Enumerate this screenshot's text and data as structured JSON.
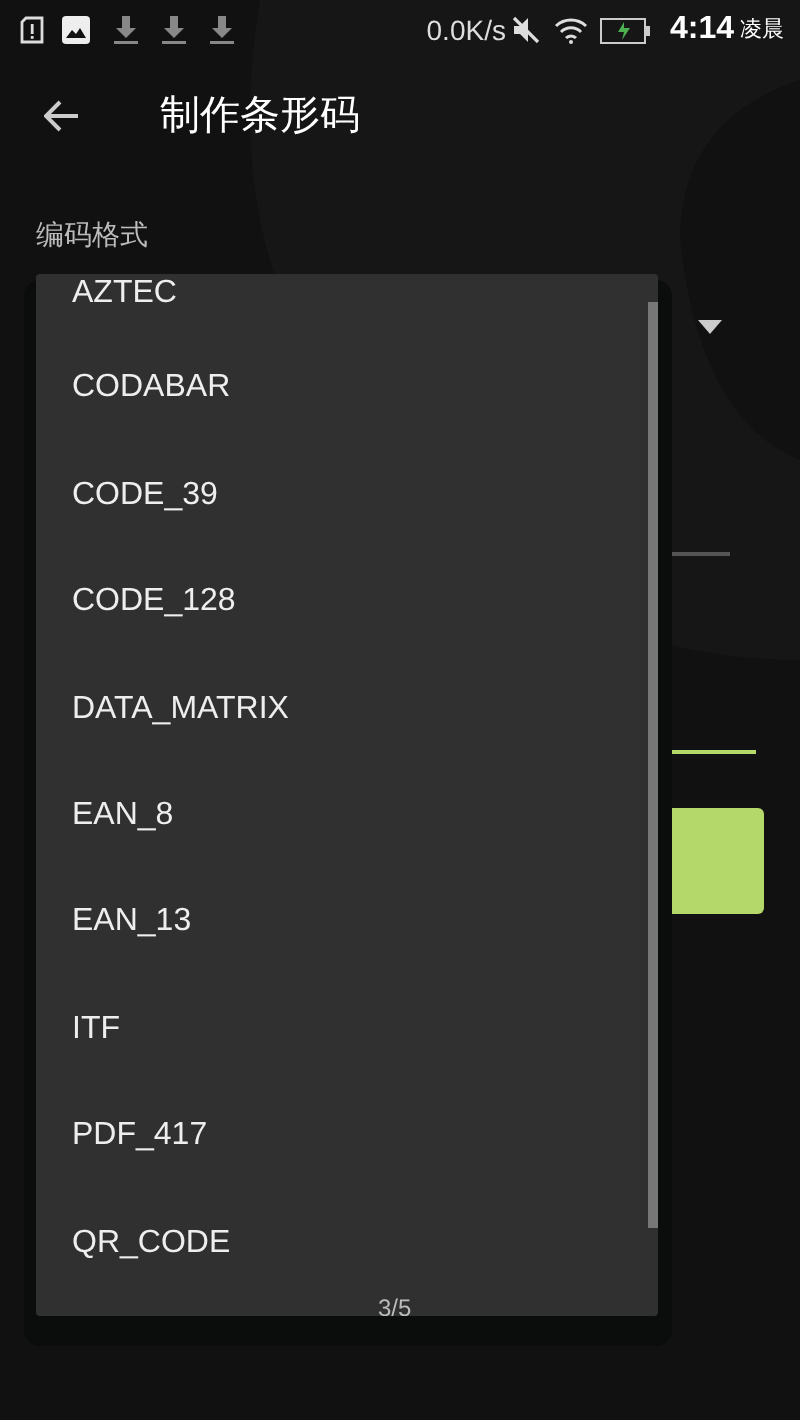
{
  "status_bar": {
    "net_speed": "0.0K/s",
    "time": "4:14",
    "period": "凌晨"
  },
  "app_bar": {
    "title": "制作条形码"
  },
  "form": {
    "format_label": "编码格式"
  },
  "dropdown": {
    "items": [
      {
        "label": "AZTEC"
      },
      {
        "label": "CODABAR"
      },
      {
        "label": "CODE_39"
      },
      {
        "label": "CODE_128"
      },
      {
        "label": "DATA_MATRIX"
      },
      {
        "label": "EAN_8"
      },
      {
        "label": "EAN_13"
      },
      {
        "label": "ITF"
      },
      {
        "label": "PDF_417"
      },
      {
        "label": "QR_CODE"
      }
    ],
    "page_indicator": "3/5"
  }
}
